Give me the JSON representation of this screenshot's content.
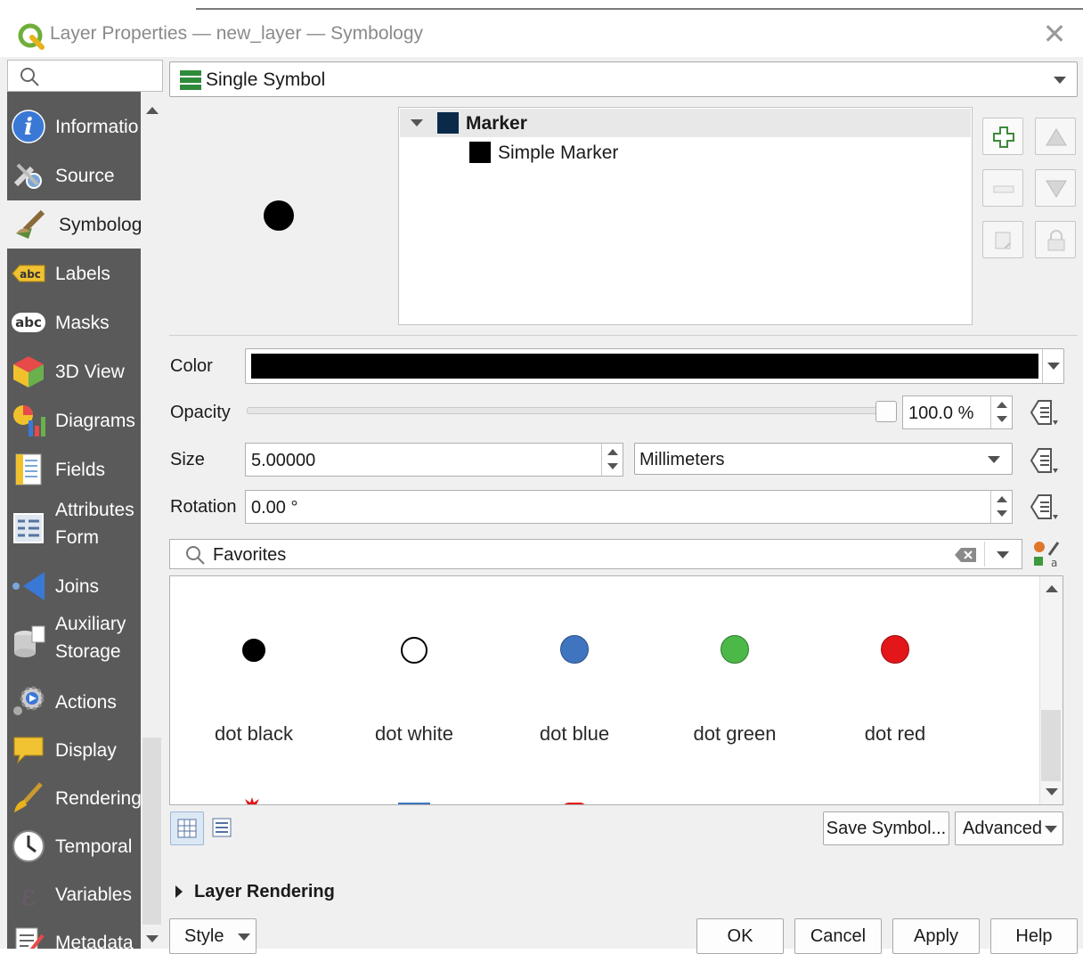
{
  "window": {
    "title": "Layer Properties — new_layer — Symbology",
    "close_icon": "close-icon"
  },
  "sidebar": {
    "search_placeholder": "",
    "items": [
      {
        "label": "Informatio",
        "icon": "information-icon"
      },
      {
        "label": "Source",
        "icon": "source-settings-icon"
      },
      {
        "label": "Symbolog",
        "icon": "symbology-brush-icon"
      },
      {
        "label": "Labels",
        "icon": "labels-abc-icon"
      },
      {
        "label": "Masks",
        "icon": "masks-abc-icon"
      },
      {
        "label": "3D View",
        "icon": "cube-3d-icon"
      },
      {
        "label": "Diagrams",
        "icon": "diagrams-icon"
      },
      {
        "label": "Fields",
        "icon": "fields-icon"
      },
      {
        "label": "Attributes",
        "label2": "Form",
        "icon": "attributes-form-icon"
      },
      {
        "label": "Joins",
        "icon": "joins-icon"
      },
      {
        "label": "Auxiliary",
        "label2": "Storage",
        "icon": "auxiliary-storage-icon"
      },
      {
        "label": "Actions",
        "icon": "actions-gear-icon"
      },
      {
        "label": "Display",
        "icon": "display-speech-icon"
      },
      {
        "label": "Rendering",
        "icon": "rendering-brush-icon"
      },
      {
        "label": "Temporal",
        "icon": "temporal-clock-icon"
      },
      {
        "label": "Variables",
        "icon": "variables-epsilon-icon"
      },
      {
        "label": "Metadata",
        "icon": "metadata-icon"
      }
    ]
  },
  "renderer": {
    "selected": "Single Symbol"
  },
  "symbol_tree": {
    "root": "Marker",
    "child": "Simple Marker"
  },
  "properties": {
    "color_label": "Color",
    "color_value": "#000000",
    "opacity_label": "Opacity",
    "opacity_value": "100.0 %",
    "opacity_fraction": 1.0,
    "size_label": "Size",
    "size_value": "5.00000",
    "size_unit": "Millimeters",
    "rotation_label": "Rotation",
    "rotation_value": "0.00 °"
  },
  "library": {
    "search_value": "Favorites",
    "symbols": [
      {
        "name": "dot  black",
        "fill": "#000000",
        "stroke": "#000000"
      },
      {
        "name": "dot  white",
        "fill": "#ffffff",
        "stroke": "#000000"
      },
      {
        "name": "dot blue",
        "fill": "#3f75bf",
        "stroke": "#2a4f87"
      },
      {
        "name": "dot green",
        "fill": "#4cb848",
        "stroke": "#2f7b2c"
      },
      {
        "name": "dot red",
        "fill": "#e3161a",
        "stroke": "#9b0e10"
      }
    ],
    "save_symbol": "Save Symbol...",
    "advanced": "Advanced"
  },
  "layer_rendering": {
    "label": "Layer Rendering"
  },
  "footer": {
    "style": "Style",
    "ok": "OK",
    "cancel": "Cancel",
    "apply": "Apply",
    "help": "Help"
  }
}
